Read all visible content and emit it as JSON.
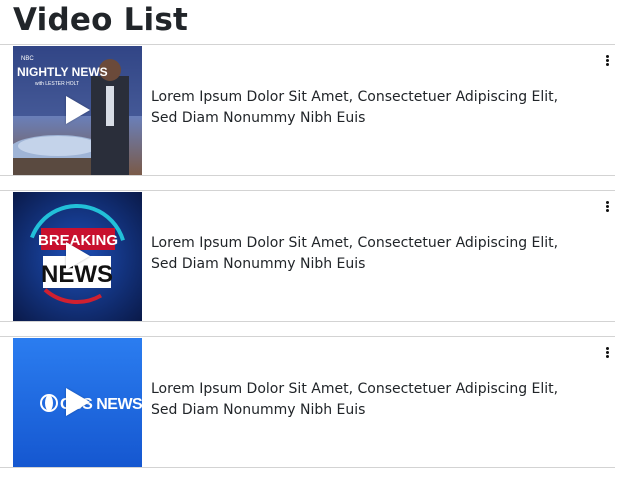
{
  "page": {
    "title": "Video List"
  },
  "videos": [
    {
      "thumbnail": "nbc-nightly-news-thumbnail",
      "thumbnail_text": [
        "NBC",
        "NIGHTLY NEWS",
        "with LESTER HOLT"
      ],
      "description": "Lorem Ipsum Dolor Sit Amet, Consectetuer Adipiscing Elit, Sed Diam Nonummy Nibh Euis"
    },
    {
      "thumbnail": "breaking-news-thumbnail",
      "thumbnail_text": [
        "BREAKING",
        "NEWS"
      ],
      "description": "Lorem Ipsum Dolor Sit Amet, Consectetuer Adipiscing Elit, Sed Diam Nonummy Nibh Euis"
    },
    {
      "thumbnail": "cbs-news-thumbnail",
      "thumbnail_text": [
        "CBS NEWS"
      ],
      "description": "Lorem Ipsum Dolor Sit Amet, Consectetuer Adipiscing Elit, Sed Diam Nonummy Nibh Euis"
    }
  ],
  "icons": {
    "play": "play-icon",
    "more": "more-vertical-icon"
  },
  "colors": {
    "title_text": "#212529",
    "divider": "#d3d3d3",
    "cbs_blue": "#1a73e8",
    "breaking_red": "#c8102e"
  }
}
